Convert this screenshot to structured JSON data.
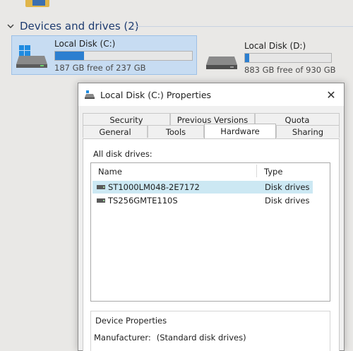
{
  "explorer": {
    "group": {
      "title": "Devices and drives (2)"
    },
    "drives": [
      {
        "name": "Local Disk (C:)",
        "free_text": "187 GB free of 237 GB",
        "used_fraction": 0.21
      },
      {
        "name": "Local Disk (D:)",
        "free_text": "883 GB free of 930 GB",
        "used_fraction": 0.05
      }
    ]
  },
  "dialog": {
    "title": "Local Disk (C:) Properties",
    "close_glyph": "✕",
    "tabs_back": [
      "Security",
      "Previous Versions",
      "Quota"
    ],
    "tabs_front": [
      "General",
      "Tools",
      "Hardware",
      "Sharing"
    ],
    "active_tab": "Hardware",
    "list_label": "All disk drives:",
    "columns": {
      "name": "Name",
      "type": "Type"
    },
    "disks": [
      {
        "name": "ST1000LM048-2E7172",
        "type": "Disk drives",
        "selected": true
      },
      {
        "name": "TS256GMTE110S",
        "type": "Disk drives",
        "selected": false
      }
    ],
    "device_properties": {
      "title": "Device Properties",
      "manufacturer_label": "Manufacturer:",
      "manufacturer_value": "(Standard disk drives)"
    }
  },
  "colors": {
    "accent": "#2c7fd0",
    "selection": "#cce8f3",
    "group_header": "#1d3b70"
  },
  "icons": [
    "folder-icon",
    "chevron-down-icon",
    "windows-drive-icon",
    "drive-icon",
    "close-icon",
    "disk-icon"
  ]
}
